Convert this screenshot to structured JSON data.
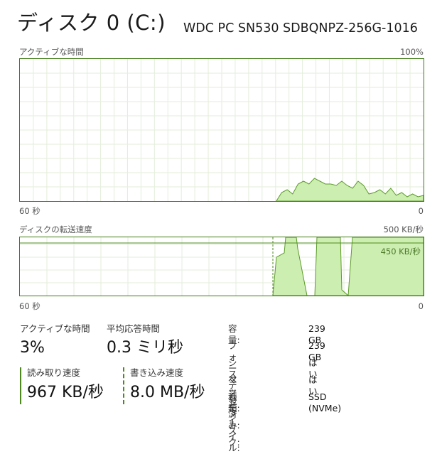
{
  "header": {
    "title": "ディスク 0 (C:)",
    "model": "WDC PC SN530 SDBQNPZ-256G-1016"
  },
  "active_graph": {
    "label": "アクティブな時間",
    "max_label": "100%",
    "time_label": "60 秒",
    "min_label": "0",
    "series_color": "#cdeeb1",
    "line_color": "#5c9a2a",
    "percent_values": [
      0,
      0,
      0,
      0,
      0,
      0,
      0,
      0,
      0,
      0,
      0,
      0,
      0,
      0,
      0,
      0,
      0,
      0,
      0,
      0,
      0,
      0,
      0,
      0,
      0,
      0,
      0,
      0,
      0,
      0,
      0,
      0,
      0,
      0,
      0,
      0,
      0,
      0,
      0,
      0,
      0,
      0,
      0,
      0,
      0,
      0,
      0,
      0,
      6,
      8,
      5,
      12,
      14,
      12,
      16,
      14,
      12,
      12,
      11,
      14,
      11,
      9,
      14,
      11,
      5,
      6,
      8,
      5,
      9,
      4,
      6,
      3,
      5,
      3,
      4
    ]
  },
  "transfer_graph": {
    "label": "ディスクの転送速度",
    "max_label": "500 KB/秒",
    "ref_label": "450 KB/秒",
    "time_label": "60 秒",
    "min_label": "0",
    "scale_max_kb": 500,
    "reference_kb": 450
  },
  "stats": {
    "active_time": {
      "label": "アクティブな時間",
      "value": "3%"
    },
    "avg_response": {
      "label": "平均応答時間",
      "value": "0.3 ミリ秒"
    },
    "read_speed": {
      "label": "読み取り速度",
      "value": "967 KB/秒"
    },
    "write_speed": {
      "label": "書き込み速度",
      "value": "8.0 MB/秒"
    }
  },
  "properties": [
    {
      "key": "容量:",
      "value": "239 GB"
    },
    {
      "key": "フォーマット済み:",
      "value": "239 GB"
    },
    {
      "key": "システム ディスク:",
      "value": "はい"
    },
    {
      "key": "ページ ファイル:",
      "value": "はい"
    },
    {
      "key": "種類:",
      "value": "SSD (NVMe)"
    }
  ]
}
